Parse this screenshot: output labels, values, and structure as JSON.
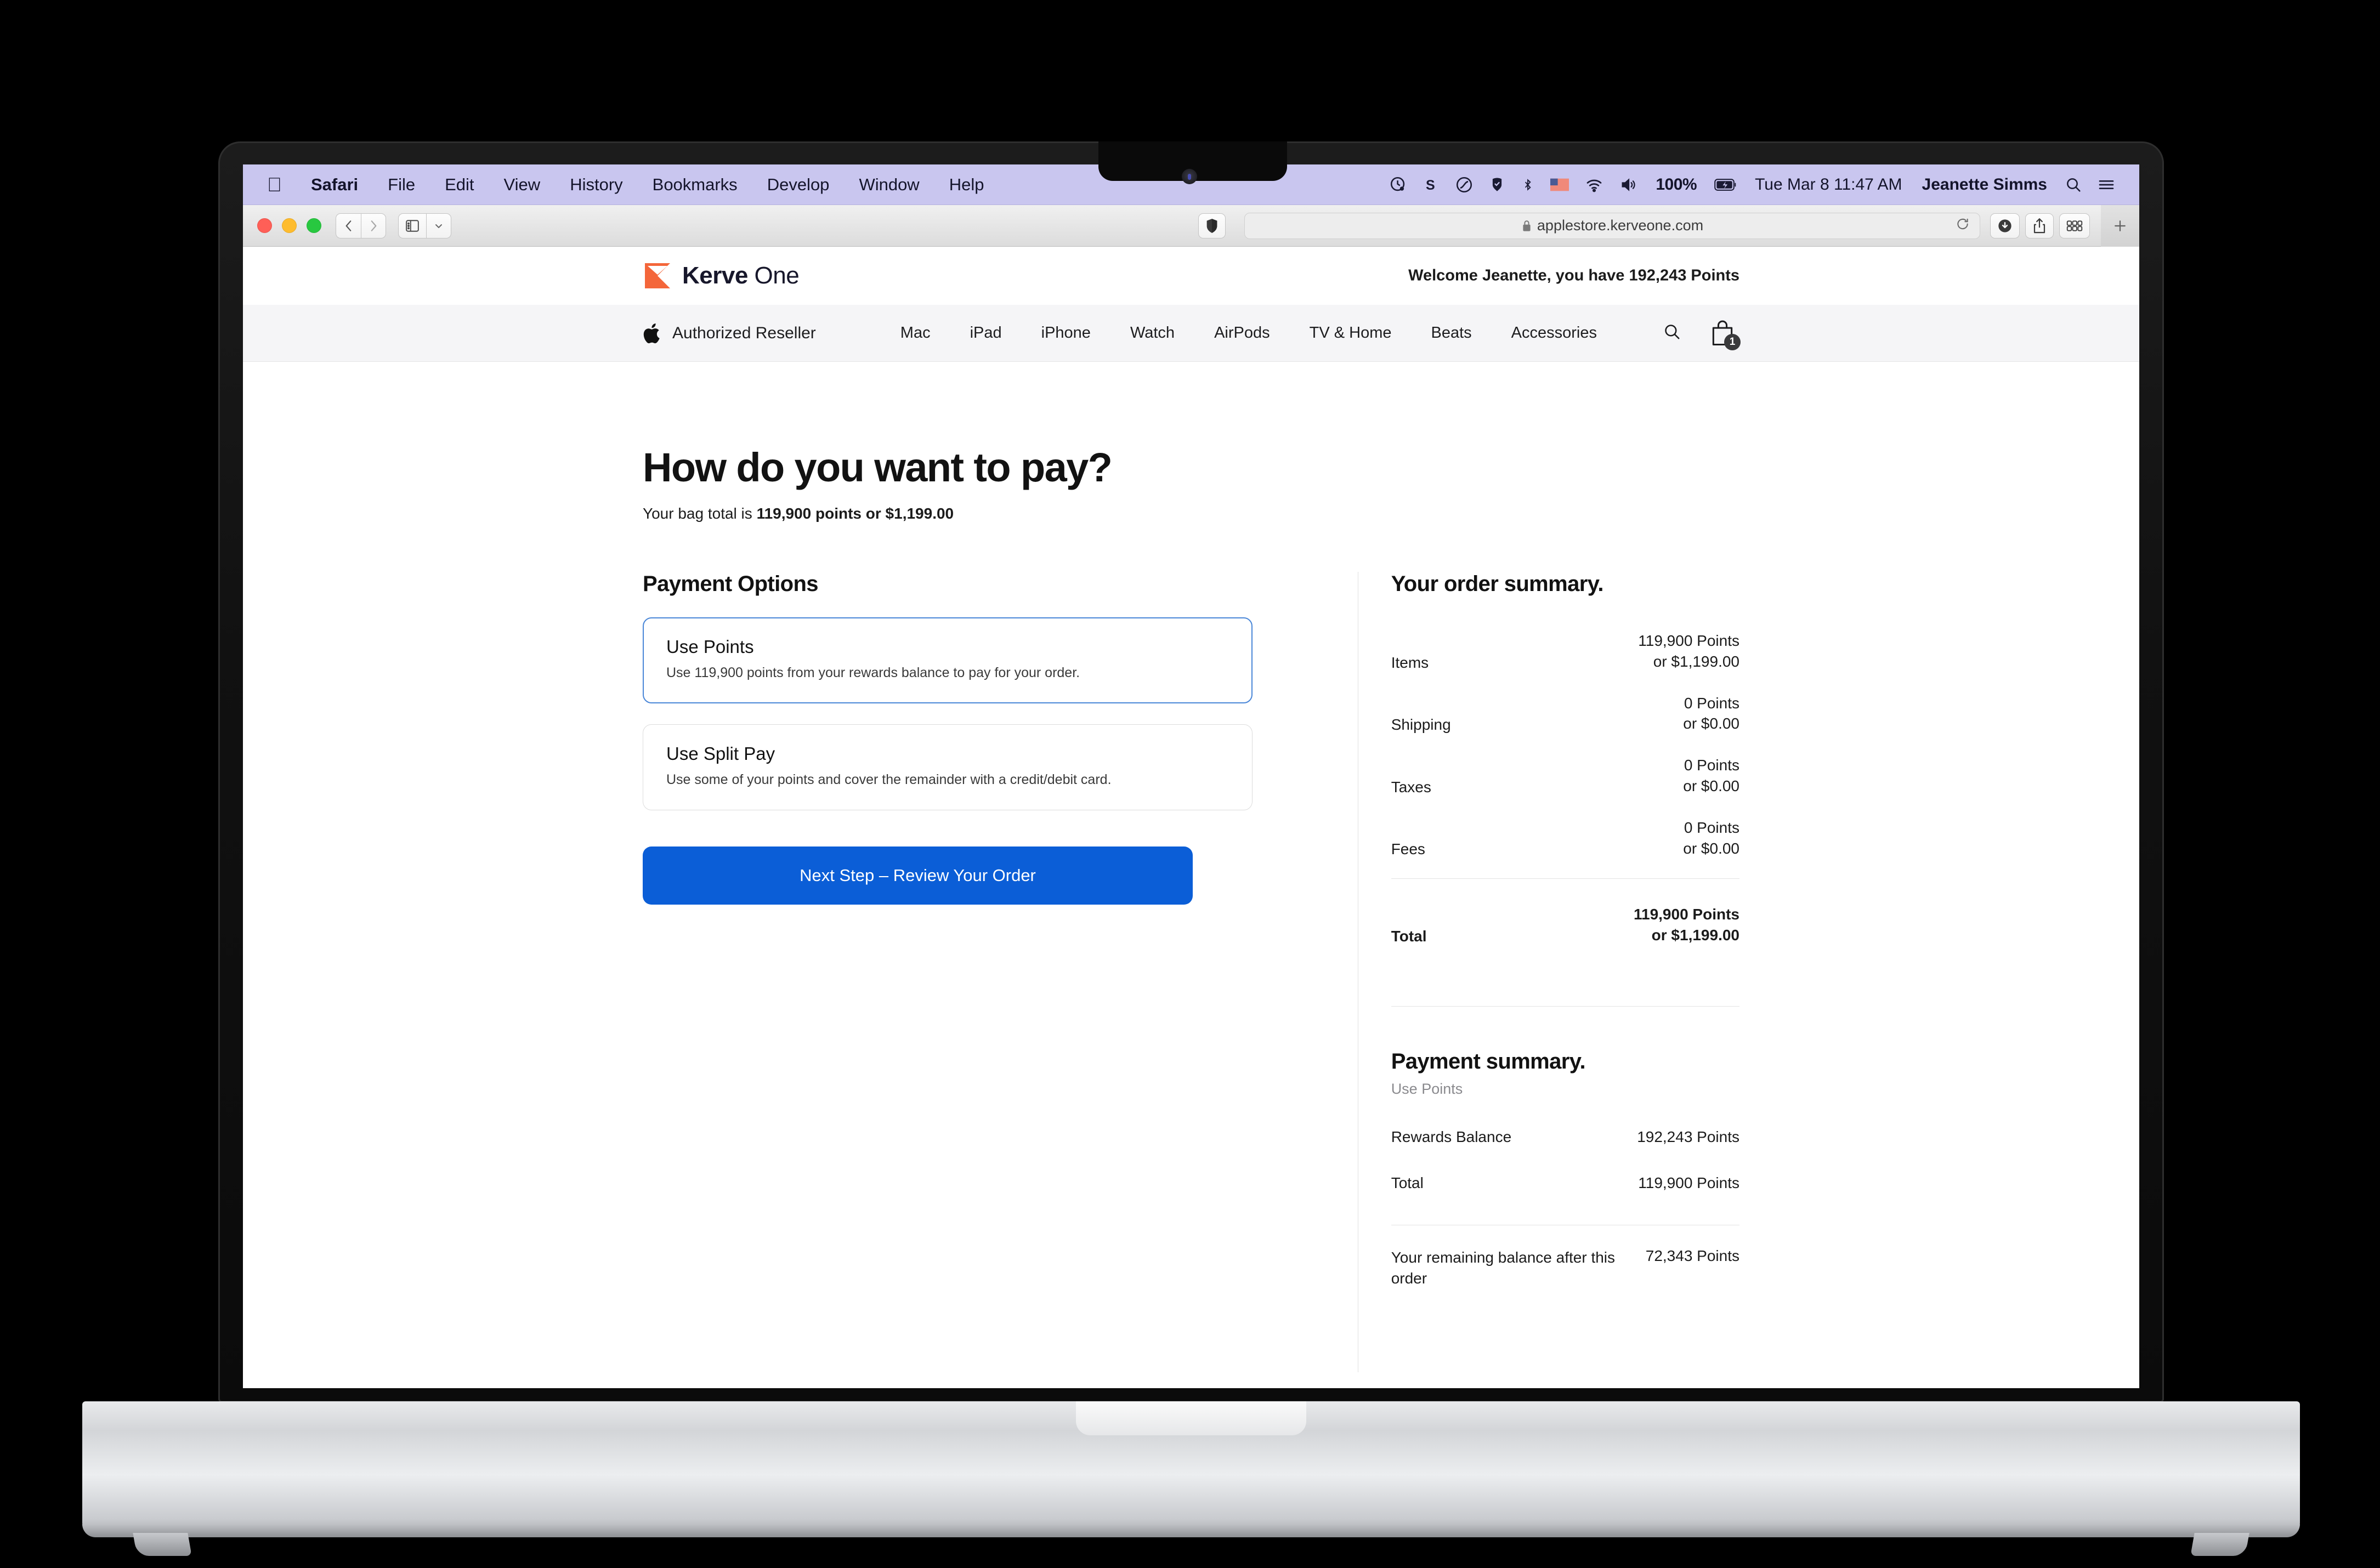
{
  "menubar": {
    "apple_icon": "apple-logo-icon",
    "items": [
      {
        "label": "Safari",
        "bold": true
      },
      {
        "label": "File",
        "bold": false
      },
      {
        "label": "Edit",
        "bold": false
      },
      {
        "label": "View",
        "bold": false
      },
      {
        "label": "History",
        "bold": false
      },
      {
        "label": "Bookmarks",
        "bold": false
      },
      {
        "label": "Develop",
        "bold": false
      },
      {
        "label": "Window",
        "bold": false
      },
      {
        "label": "Help",
        "bold": false
      }
    ],
    "status_icons": [
      "screen-time-icon",
      "shortcuts-icon",
      "handoff-icon",
      "dropbox-icon",
      "bluetooth-icon",
      "keyboard-flag-icon",
      "wifi-icon",
      "volume-icon"
    ],
    "battery_percent": "100%",
    "battery_icon": "battery-charging-icon",
    "clock": "Tue Mar 8  11:47 AM",
    "user": "Jeanette Simms",
    "spotlight_icon": "search-icon",
    "control_center_icon": "control-center-icon",
    "bg_color": "#c9c6ef"
  },
  "browser": {
    "window_controls": [
      "close",
      "minimize",
      "zoom"
    ],
    "back_icon": "chevron-left-icon",
    "forward_icon": "chevron-right-icon",
    "sidebar_icon": "sidebar-icon",
    "sidebar_chevron_icon": "chevron-down-icon",
    "shield_icon": "privacy-shield-icon",
    "url": "applestore.kerveone.com",
    "lock_icon": "lock-icon",
    "reload_icon": "reload-icon",
    "downloads_icon": "download-icon",
    "share_icon": "share-icon",
    "tab-overview_icon": "tab-overview-icon",
    "new_tab_icon": "plus-icon"
  },
  "site": {
    "brand": {
      "name_bold": "Kerve",
      "name_light": "One",
      "logo_icon": "kerve-hourglass-logo",
      "logo_color": "#f4663a"
    },
    "welcome": "Welcome Jeanette, you have 192,243 Points",
    "reseller_label": "Authorized Reseller",
    "reseller_icon": "apple-logo-icon",
    "nav": [
      {
        "label": "Mac"
      },
      {
        "label": "iPad"
      },
      {
        "label": "iPhone"
      },
      {
        "label": "Watch"
      },
      {
        "label": "AirPods"
      },
      {
        "label": "TV & Home"
      },
      {
        "label": "Beats"
      },
      {
        "label": "Accessories"
      }
    ],
    "search_icon": "search-icon",
    "bag_icon": "shopping-bag-icon",
    "bag_count": "1"
  },
  "main": {
    "title": "How do you want to pay?",
    "bag_total_prefix": "Your bag total is ",
    "bag_total_value": "119,900 points or $1,199.00",
    "payment_options_title": "Payment Options",
    "options": [
      {
        "title": "Use Points",
        "description": "Use 119,900 points from your rewards balance to pay for your order.",
        "selected": true
      },
      {
        "title": "Use Split Pay",
        "description": "Use some of your points and cover the remainder with a credit/debit card.",
        "selected": false
      }
    ],
    "cta_label": "Next Step – Review Your Order",
    "cta_color": "#0b5ed7",
    "selected_border_color": "#4a87d8"
  },
  "order_summary": {
    "title": "Your order summary.",
    "rows": [
      {
        "label": "Items",
        "points": "119,900 Points",
        "amount": "or $1,199.00"
      },
      {
        "label": "Shipping",
        "points": "0 Points",
        "amount": "or $0.00"
      },
      {
        "label": "Taxes",
        "points": "0 Points",
        "amount": "or $0.00"
      },
      {
        "label": "Fees",
        "points": "0 Points",
        "amount": "or $0.00"
      }
    ],
    "total": {
      "label": "Total",
      "points": "119,900 Points",
      "amount": "or $1,199.00"
    }
  },
  "payment_summary": {
    "title": "Payment summary.",
    "method": "Use Points",
    "rows": [
      {
        "label": "Rewards Balance",
        "value": "192,243 Points"
      },
      {
        "label": "Total",
        "value": "119,900 Points"
      }
    ],
    "remaining": {
      "label": "Your remaining balance after this order",
      "value": "72,343 Points"
    }
  }
}
